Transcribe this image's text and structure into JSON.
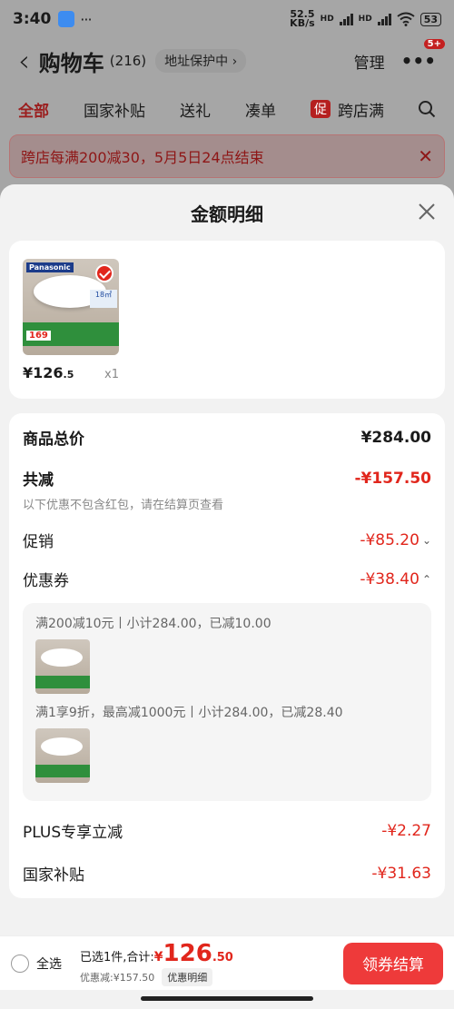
{
  "status_bar": {
    "time": "3:40",
    "dots": "···",
    "net_speed": "52.5",
    "net_unit": "KB/s",
    "hd1": "HD",
    "hd2": "HD",
    "battery": "53"
  },
  "cart_header": {
    "back_glyph": "‹",
    "title": "购物车",
    "count": "(216)",
    "protect": "地址保护中 ›",
    "manage": "管理",
    "more_glyph": "•••",
    "badge": "5+"
  },
  "cart_tabs": [
    "全部",
    "国家补贴",
    "送礼",
    "凑单"
  ],
  "promo_tab": {
    "tag": "促",
    "label": "跨店满"
  },
  "promo_banner": {
    "text": "跨店每满200减30，5月5日24点结束",
    "close": "✕"
  },
  "sheet": {
    "title": "金额明细",
    "product": {
      "brand": "Panasonic",
      "spec": "18㎡",
      "badge_price": "169",
      "price_int": "¥126",
      "price_dec": ".5",
      "qty": "x1"
    },
    "rows": {
      "total_label": "商品总价",
      "total_value": "¥284.00",
      "discount_label": "共减",
      "discount_value": "-¥157.50",
      "discount_note": "以下优惠不包含红包，请在结算页查看",
      "promo_label": "促销",
      "promo_value": "-¥85.20",
      "coupon_label": "优惠券",
      "coupon_value": "-¥38.40",
      "plus_label": "PLUS专享立减",
      "plus_value": "-¥2.27",
      "subsidy_label": "国家补贴",
      "subsidy_value": "-¥31.63"
    },
    "coupons": [
      {
        "text": "满200减10元丨小计284.00，已减10.00"
      },
      {
        "text": "满1享9折，最高减1000元丨小计284.00，已减28.40"
      }
    ],
    "chevron_down": "⌄",
    "chevron_up": "⌃"
  },
  "bottom_bar": {
    "select_all": "全选",
    "selected_text": "已选1件,合计:",
    "currency": "¥",
    "total_int": "126",
    "total_dec": ".50",
    "saved": "优惠减:¥157.50",
    "detail_btn": "优惠明细",
    "checkout": "领券结算"
  },
  "colors": {
    "accent": "#e1261c",
    "checkout": "#ee3a3a",
    "overlay": "#a6a6a6"
  }
}
